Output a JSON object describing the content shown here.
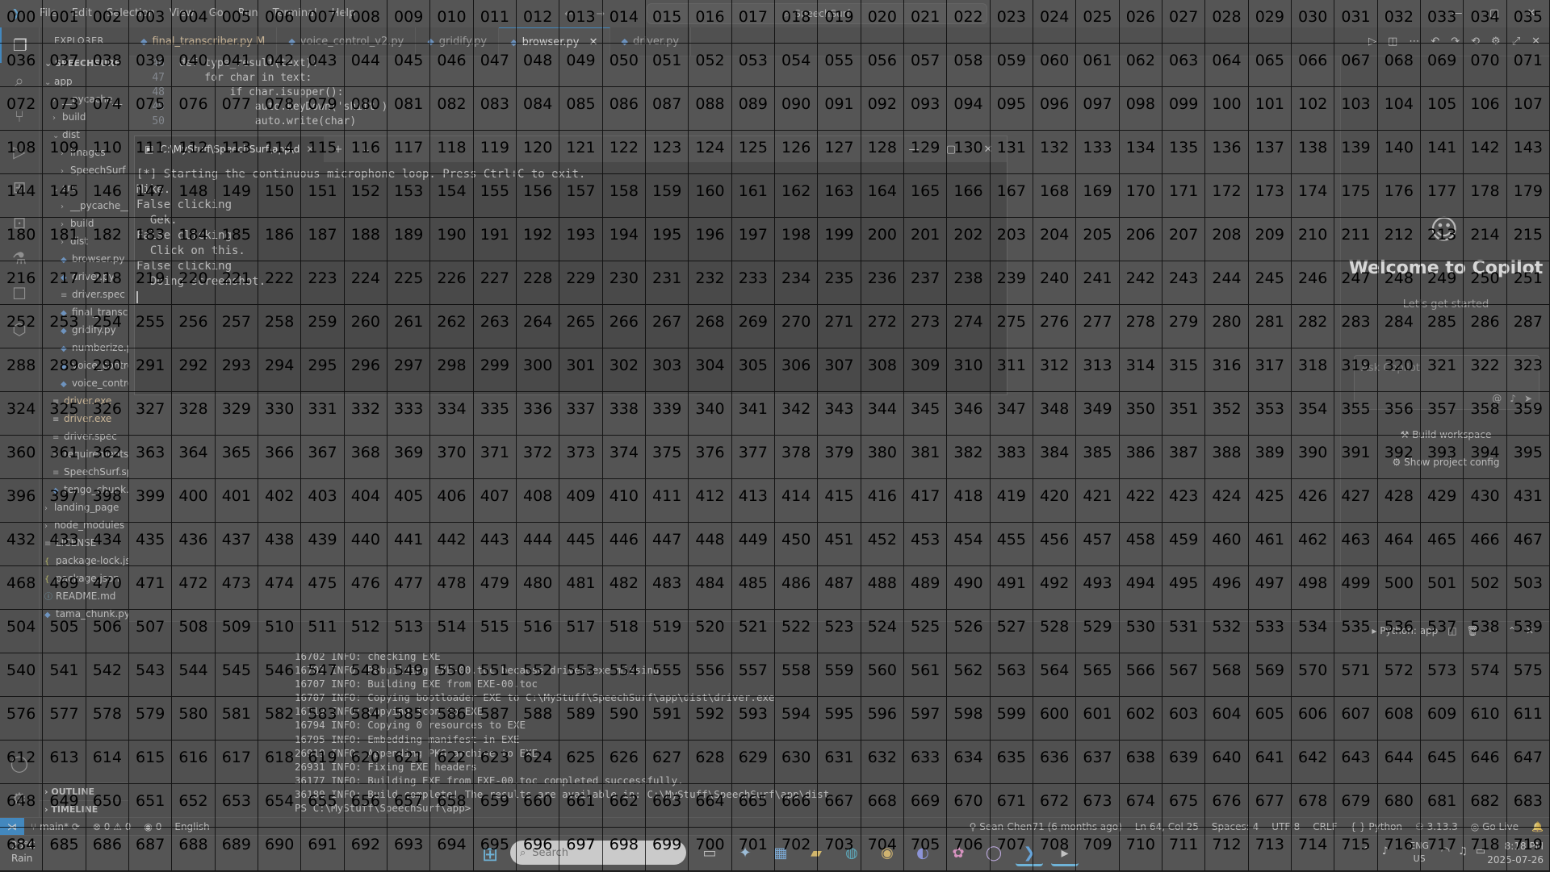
{
  "titlebar": {
    "menus": [
      "File",
      "Edit",
      "Selection",
      "View",
      "Go",
      "Run",
      "Terminal",
      "Help"
    ],
    "search_text": "SpeechSurf"
  },
  "sidebar": {
    "header": "EXPLORER",
    "section": "SPEECHSURF",
    "rows": [
      {
        "label": "app",
        "kind": "folder-open",
        "indent": 0
      },
      {
        "label": "__pycache__",
        "kind": "folder",
        "indent": 1
      },
      {
        "label": "build",
        "kind": "folder",
        "indent": 1
      },
      {
        "label": "dist",
        "kind": "folder-open",
        "indent": 1
      },
      {
        "label": "images",
        "kind": "folder",
        "indent": 2
      },
      {
        "label": "SpeechSurf",
        "kind": "folder",
        "indent": 2
      },
      {
        "label": "src",
        "kind": "folder-open",
        "indent": 1
      },
      {
        "label": "__pycache__",
        "kind": "folder",
        "indent": 2
      },
      {
        "label": "build",
        "kind": "folder",
        "indent": 2
      },
      {
        "label": "dist",
        "kind": "folder",
        "indent": 2
      },
      {
        "label": "browser.py",
        "kind": "py",
        "indent": 2
      },
      {
        "label": "driver.py",
        "kind": "py",
        "indent": 2
      },
      {
        "label": "driver.spec",
        "kind": "file",
        "indent": 2
      },
      {
        "label": "final_transcriber.py",
        "kind": "py",
        "indent": 2
      },
      {
        "label": "gridify.py",
        "kind": "py",
        "indent": 2
      },
      {
        "label": "numberize.py",
        "kind": "py",
        "indent": 2
      },
      {
        "label": "voice_control.py",
        "kind": "py",
        "indent": 2
      },
      {
        "label": "voice_control_v2.py",
        "kind": "py",
        "indent": 2
      },
      {
        "label": "driver.exe",
        "kind": "exe",
        "indent": 1
      },
      {
        "label": "driver.exe",
        "kind": "exe",
        "indent": 1
      },
      {
        "label": "driver.spec",
        "kind": "file",
        "indent": 1
      },
      {
        "label": "requirements.txt",
        "kind": "file",
        "indent": 1
      },
      {
        "label": "SpeechSurf.spec",
        "kind": "file",
        "indent": 1
      },
      {
        "label": "tengo_chunk.py",
        "kind": "py",
        "indent": 1
      },
      {
        "label": "landing_page",
        "kind": "folder",
        "indent": 0
      },
      {
        "label": "node_modules",
        "kind": "folder",
        "indent": 0
      },
      {
        "label": "LICENSE",
        "kind": "file",
        "indent": 0
      },
      {
        "label": "package-lock.json",
        "kind": "json",
        "indent": 0
      },
      {
        "label": "package.json",
        "kind": "json",
        "indent": 0
      },
      {
        "label": "README.md",
        "kind": "md",
        "indent": 0
      },
      {
        "label": "tama_chunk.py",
        "kind": "py",
        "indent": 0
      }
    ],
    "outline": "OUTLINE",
    "timeline": "TIMELINE"
  },
  "tabs": [
    {
      "label": "final_transcriber.py M",
      "active": false,
      "modified": true
    },
    {
      "label": "voice_control_v2.py",
      "active": false,
      "modified": false
    },
    {
      "label": "gridify.py",
      "active": false,
      "modified": false
    },
    {
      "label": "browser.py",
      "active": true,
      "modified": false
    },
    {
      "label": "driver.py",
      "active": false,
      "modified": false
    }
  ],
  "editor": {
    "lines": [
      {
        "num": "46",
        "text": "def type_result(text):"
      },
      {
        "num": "47",
        "text": "    for char in text:"
      },
      {
        "num": "48",
        "text": "        if char.isupper():"
      },
      {
        "num": "49",
        "text": "            auto.keyDown('shift')"
      },
      {
        "num": "50",
        "text": "            auto.write(char)"
      }
    ]
  },
  "cmd_window": {
    "tab_title": "C:\\MyStuff\\SpeechSurf\\app\\d",
    "lines": [
      "[*] Starting the continuous microphone loop. Press Ctrl+C to exit.",
      "Mike.",
      "False clicking",
      "  Gek.",
      "False clicking",
      "  Click on this.",
      "False clicking",
      "  Doing screenshot."
    ]
  },
  "copilot": {
    "title": "Welcome to Copilot",
    "subtitle": "Let's get started",
    "input_placeholder": "Ask Copilot",
    "actions": [
      "Build workspace",
      "Show project config"
    ]
  },
  "terminal": {
    "panel_label": "Python: app",
    "lines": [
      "16702 INFO: checking EXE",
      "16703 INFO: Rebuilding EXE-00.toc because driver.exe missing",
      "16707 INFO: Building EXE from EXE-00.toc",
      "16707 INFO: Copying bootloader EXE to C:\\MyStuff\\SpeechSurf\\app\\dist\\driver.exe",
      "16719 INFO: Copying icon to EXE",
      "16794 INFO: Copying 0 resources to EXE",
      "16795 INFO: Embedding manifest in EXE",
      "26919 INFO: Appending PKG archive to EXE",
      "26931 INFO: Fixing EXE headers",
      "36177 INFO: Building EXE from EXE-00.toc completed successfully.",
      "36180 INFO: Build complete! The results are available in: C:\\MyStuff\\SpeechSurf\\app\\dist",
      "PS C:\\MyStuff\\SpeechSurf\\app> "
    ]
  },
  "statusbar": {
    "branch": "main*",
    "problems": "⊗ 0  ⚠ 0",
    "ports": "0",
    "language_mode": "English",
    "blame": "Sean-Chen71 (6 months ago)",
    "cursor": "Ln 64, Col 25",
    "spaces": "Spaces: 4",
    "encoding": "UTF-8",
    "eol": "CRLF",
    "language": "Python",
    "python_version": "3.13.3",
    "golive": "Go Live"
  },
  "taskbar": {
    "weather_temp": "25°C",
    "weather_cond": "Rain",
    "search_placeholder": "Search",
    "apps": [
      {
        "name": "file-explorer-app",
        "glyph": "▭",
        "color": "#cfcfcf",
        "active": false
      },
      {
        "name": "copilot-app",
        "glyph": "✦",
        "color": "#9ad0ff",
        "active": false
      },
      {
        "name": "store-app",
        "glyph": "▦",
        "color": "#63b3ff",
        "active": false
      },
      {
        "name": "folder-app",
        "glyph": "▰",
        "color": "#f7c948",
        "active": false
      },
      {
        "name": "edge-app",
        "glyph": "◍",
        "color": "#2fb6d8",
        "active": false
      },
      {
        "name": "chrome-app",
        "glyph": "◉",
        "color": "#f2c14e",
        "active": false
      },
      {
        "name": "discord-app",
        "glyph": "◐",
        "color": "#7f8cff",
        "active": false
      },
      {
        "name": "photos-app",
        "glyph": "✿",
        "color": "#ff8ad8",
        "active": false
      },
      {
        "name": "github-app",
        "glyph": "◯",
        "color": "#c9a9ff",
        "active": false
      },
      {
        "name": "vscode-app",
        "glyph": "❯",
        "color": "#3ea6ff",
        "active": true
      },
      {
        "name": "terminal-app",
        "glyph": "▸",
        "color": "#dddddd",
        "active": true
      }
    ],
    "lang_top": "ENG",
    "lang_bottom": "US",
    "time": "8:18 PM",
    "date": "2025-07-26"
  },
  "grid": {
    "columns": 36,
    "rows": 20,
    "digits": 3
  }
}
